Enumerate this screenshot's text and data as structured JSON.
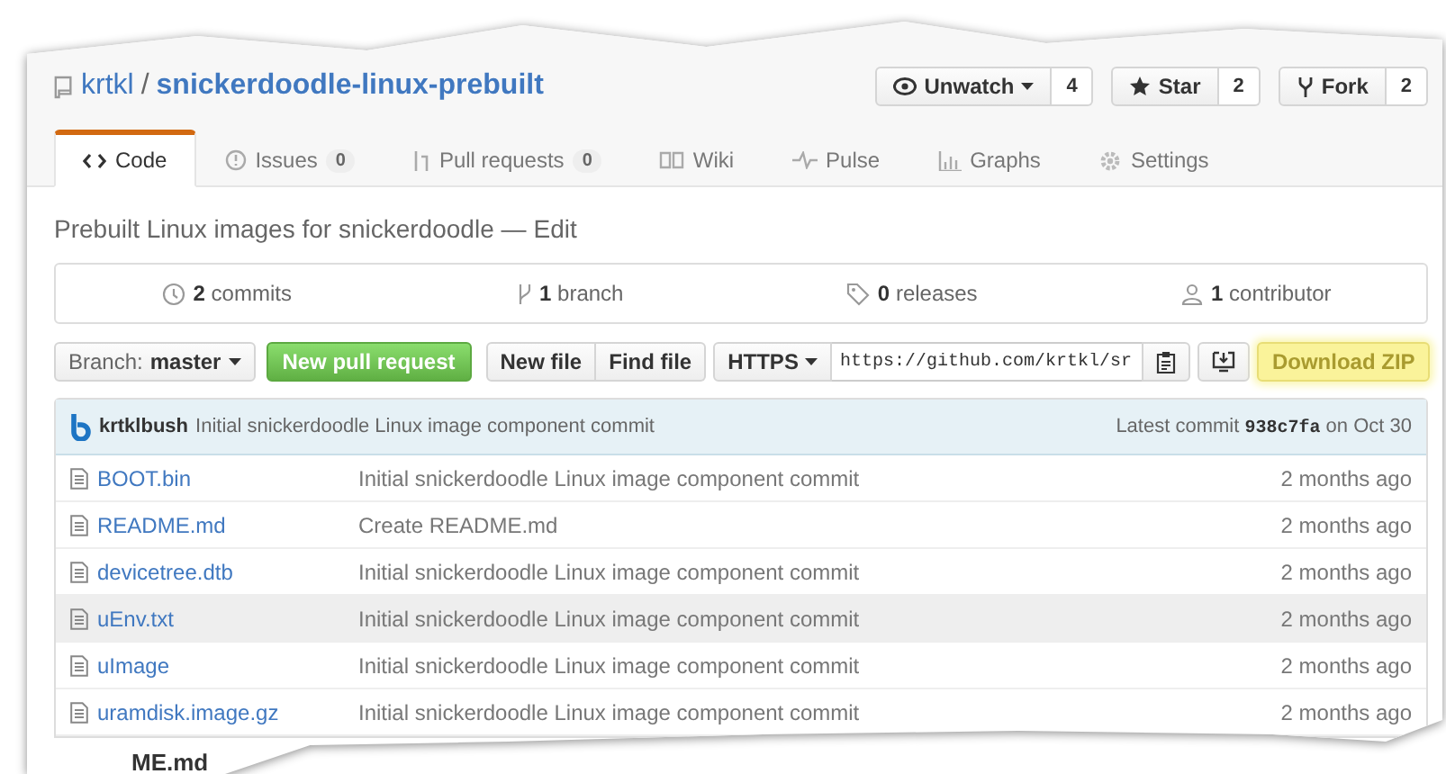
{
  "repo": {
    "owner": "krtkl",
    "separator": "/",
    "name": "snickerdoodle-linux-prebuilt"
  },
  "actions": [
    {
      "kind": "watch",
      "label": "Unwatch",
      "count": "4"
    },
    {
      "kind": "star",
      "label": "Star",
      "count": "2"
    },
    {
      "kind": "fork",
      "label": "Fork",
      "count": "2"
    }
  ],
  "tabs": [
    {
      "kind": "code",
      "label": "Code",
      "selected": true
    },
    {
      "kind": "issues",
      "label": "Issues",
      "count": "0",
      "selected": false
    },
    {
      "kind": "pulls",
      "label": "Pull requests",
      "count": "0",
      "selected": false
    },
    {
      "kind": "wiki",
      "label": "Wiki",
      "selected": false
    },
    {
      "kind": "pulse",
      "label": "Pulse",
      "selected": false
    },
    {
      "kind": "graphs",
      "label": "Graphs",
      "selected": false
    },
    {
      "kind": "settings",
      "label": "Settings",
      "selected": false
    }
  ],
  "description": {
    "text": "Prebuilt Linux images for snickerdoodle —",
    "edit": "Edit"
  },
  "summary": [
    {
      "kind": "commits",
      "count": "2",
      "label": "commits"
    },
    {
      "kind": "branch",
      "count": "1",
      "label": "branch"
    },
    {
      "kind": "releases",
      "count": "0",
      "label": "releases"
    },
    {
      "kind": "contributors",
      "count": "1",
      "label": "contributor"
    }
  ],
  "toolbar": {
    "branch_label": "Branch:",
    "branch": "master",
    "new_pull_request": "New pull request",
    "new_file": "New file",
    "find_file": "Find file",
    "protocol": "HTTPS",
    "clone_url": "https://github.com/krtkl/sr",
    "download": "Download ZIP",
    "download_highlighted": true
  },
  "commit": {
    "author": "krtklbush",
    "message": "Initial snickerdoodle Linux image component commit",
    "latest_label": "Latest commit",
    "sha": "938c7fa",
    "date": "on Oct 30"
  },
  "files": [
    {
      "name": "BOOT.bin",
      "message": "Initial snickerdoodle Linux image component commit",
      "age": "2 months ago",
      "highlighted": false
    },
    {
      "name": "README.md",
      "message": "Create README.md",
      "age": "2 months ago",
      "highlighted": false
    },
    {
      "name": "devicetree.dtb",
      "message": "Initial snickerdoodle Linux image component commit",
      "age": "2 months ago",
      "highlighted": false
    },
    {
      "name": "uEnv.txt",
      "message": "Initial snickerdoodle Linux image component commit",
      "age": "2 months ago",
      "highlighted": true
    },
    {
      "name": "uImage",
      "message": "Initial snickerdoodle Linux image component commit",
      "age": "2 months ago",
      "highlighted": false
    },
    {
      "name": "uramdisk.image.gz",
      "message": "Initial snickerdoodle Linux image component commit",
      "age": "2 months ago",
      "highlighted": false
    }
  ],
  "readme_heading": "ME.md"
}
